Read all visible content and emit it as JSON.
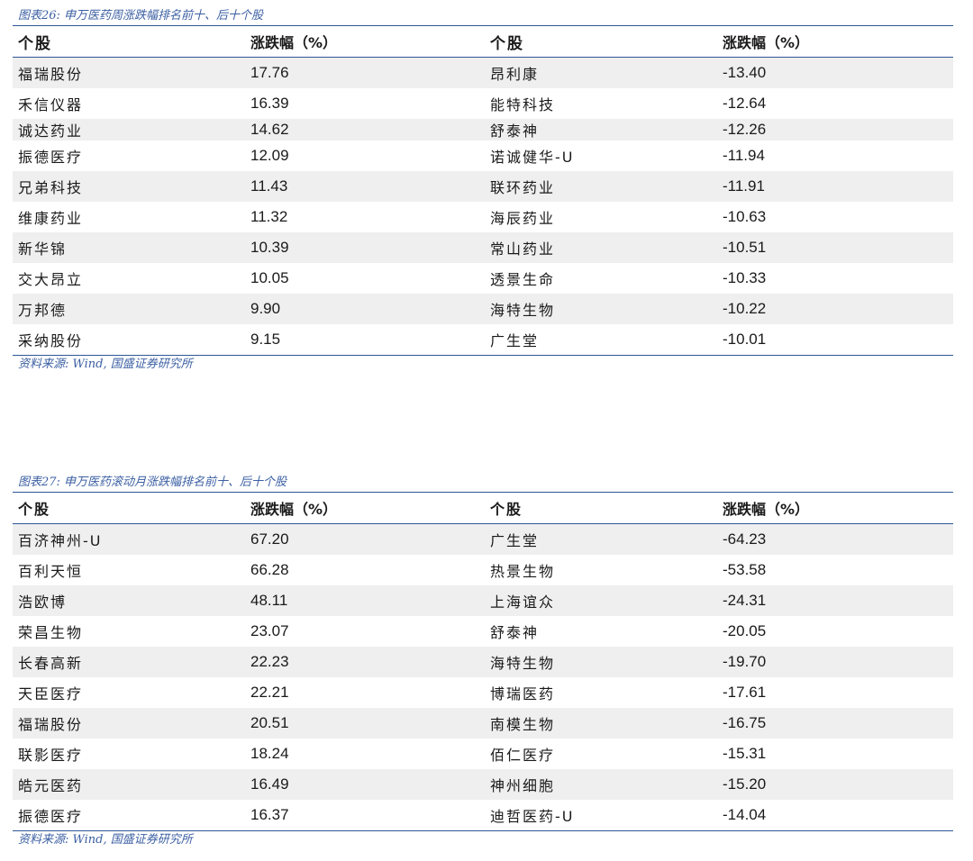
{
  "table1": {
    "caption": "图表26:  申万医药周涨跌幅排名前十、后十个股",
    "headers": [
      "个股",
      "涨跌幅（%）",
      "个股",
      "涨跌幅（%）"
    ],
    "rows": [
      [
        "福瑞股份",
        "17.76",
        "昂利康",
        "-13.40"
      ],
      [
        "禾信仪器",
        "16.39",
        "能特科技",
        "-12.64"
      ],
      [
        "诚达药业",
        "14.62",
        "舒泰神",
        "-12.26"
      ],
      [
        "振德医疗",
        "12.09",
        "诺诚健华-U",
        "-11.94"
      ],
      [
        "兄弟科技",
        "11.43",
        "联环药业",
        "-11.91"
      ],
      [
        "维康药业",
        "11.32",
        "海辰药业",
        "-10.63"
      ],
      [
        "新华锦",
        "10.39",
        "常山药业",
        "-10.51"
      ],
      [
        "交大昂立",
        "10.05",
        "透景生命",
        "-10.33"
      ],
      [
        "万邦德",
        "9.90",
        "海特生物",
        "-10.22"
      ],
      [
        "采纳股份",
        "9.15",
        "广生堂",
        "-10.01"
      ]
    ],
    "source": "资料来源:  Wind,  国盛证券研究所"
  },
  "table2": {
    "caption": "图表27:  申万医药滚动月涨跌幅排名前十、后十个股",
    "headers": [
      "个股",
      "涨跌幅（%）",
      "个股",
      "涨跌幅（%）"
    ],
    "rows": [
      [
        "百济神州-U",
        "67.20",
        "广生堂",
        "-64.23"
      ],
      [
        "百利天恒",
        "66.28",
        "热景生物",
        "-53.58"
      ],
      [
        "浩欧博",
        "48.11",
        "上海谊众",
        "-24.31"
      ],
      [
        "荣昌生物",
        "23.07",
        "舒泰神",
        "-20.05"
      ],
      [
        "长春高新",
        "22.23",
        "海特生物",
        "-19.70"
      ],
      [
        "天臣医疗",
        "22.21",
        "博瑞医药",
        "-17.61"
      ],
      [
        "福瑞股份",
        "20.51",
        "南模生物",
        "-16.75"
      ],
      [
        "联影医疗",
        "18.24",
        "佰仁医疗",
        "-15.31"
      ],
      [
        "皓元医药",
        "16.49",
        "神州细胞",
        "-15.20"
      ],
      [
        "振德医疗",
        "16.37",
        "迪哲医药-U",
        "-14.04"
      ]
    ],
    "source": "资料来源:  Wind,  国盛证券研究所"
  }
}
